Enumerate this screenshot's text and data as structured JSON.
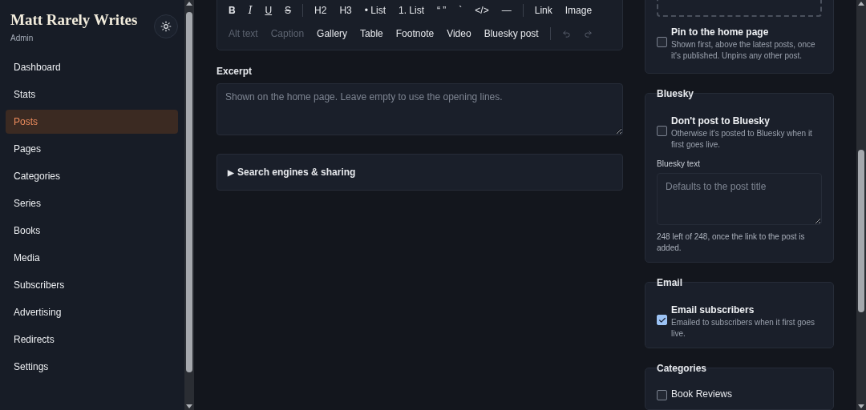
{
  "sidebar": {
    "title": "Matt Rarely Writes",
    "subtitle": "Admin",
    "items": [
      {
        "label": "Dashboard",
        "selected": false
      },
      {
        "label": "Stats",
        "selected": false
      },
      {
        "label": "Posts",
        "selected": true
      },
      {
        "label": "Pages",
        "selected": false
      },
      {
        "label": "Categories",
        "selected": false
      },
      {
        "label": "Series",
        "selected": false
      },
      {
        "label": "Books",
        "selected": false
      },
      {
        "label": "Media",
        "selected": false
      },
      {
        "label": "Subscribers",
        "selected": false
      },
      {
        "label": "Advertising",
        "selected": false
      },
      {
        "label": "Redirects",
        "selected": false
      },
      {
        "label": "Settings",
        "selected": false
      }
    ]
  },
  "toolbar": {
    "format_row": [
      {
        "label": "B",
        "kind": "bold",
        "disabled": false
      },
      {
        "label": "I",
        "kind": "italic",
        "disabled": false
      },
      {
        "label": "U",
        "kind": "underline",
        "disabled": false
      },
      {
        "label": "S",
        "kind": "strike",
        "disabled": false
      },
      {
        "kind": "divider"
      },
      {
        "label": "H2",
        "kind": "text",
        "disabled": false
      },
      {
        "label": "H3",
        "kind": "text",
        "disabled": false
      },
      {
        "label": "• List",
        "kind": "text",
        "disabled": false
      },
      {
        "label": "1. List",
        "kind": "text",
        "disabled": false
      },
      {
        "label": "“ ”",
        "kind": "text",
        "disabled": false
      },
      {
        "label": "`",
        "kind": "text",
        "disabled": false
      },
      {
        "label": "</>",
        "kind": "text",
        "disabled": false
      },
      {
        "label": "—",
        "kind": "text",
        "disabled": false
      },
      {
        "kind": "divider"
      },
      {
        "label": "Link",
        "kind": "text",
        "disabled": false
      },
      {
        "label": "Image",
        "kind": "text",
        "disabled": false
      }
    ],
    "insert_row": [
      {
        "label": "Alt text",
        "kind": "text",
        "disabled": true
      },
      {
        "label": "Caption",
        "kind": "text",
        "disabled": true
      },
      {
        "label": "Gallery",
        "kind": "text",
        "disabled": false
      },
      {
        "label": "Table",
        "kind": "text",
        "disabled": false
      },
      {
        "label": "Footnote",
        "kind": "text",
        "disabled": false
      },
      {
        "label": "Video",
        "kind": "text",
        "disabled": false
      },
      {
        "label": "Bluesky post",
        "kind": "text",
        "disabled": false
      },
      {
        "kind": "divider"
      },
      {
        "kind": "undo",
        "disabled": true
      },
      {
        "kind": "redo",
        "disabled": true
      }
    ]
  },
  "excerpt": {
    "label": "Excerpt",
    "placeholder": "Shown on the home page. Leave empty to use the opening lines."
  },
  "seo": {
    "label": "Search engines & sharing",
    "marker": "▶",
    "expanded": false
  },
  "pin": {
    "label": "Pin to the home page",
    "hint": "Shown first, above the latest posts, once it's published. Unpins any other post.",
    "checked": false
  },
  "bluesky": {
    "heading": "Bluesky",
    "option": {
      "label": "Don't post to Bluesky",
      "hint": "Otherwise it's posted to Bluesky when it first goes live.",
      "checked": false
    },
    "text_label": "Bluesky text",
    "placeholder": "Defaults to the post title",
    "counter": "248 left of 248, once the link to the post is added."
  },
  "email": {
    "heading": "Email",
    "option": {
      "label": "Email subscribers",
      "hint": "Emailed to subscribers when it first goes live.",
      "checked": true
    }
  },
  "categories": {
    "heading": "Categories",
    "items": [
      {
        "label": "Book Reviews",
        "checked": false
      }
    ]
  }
}
